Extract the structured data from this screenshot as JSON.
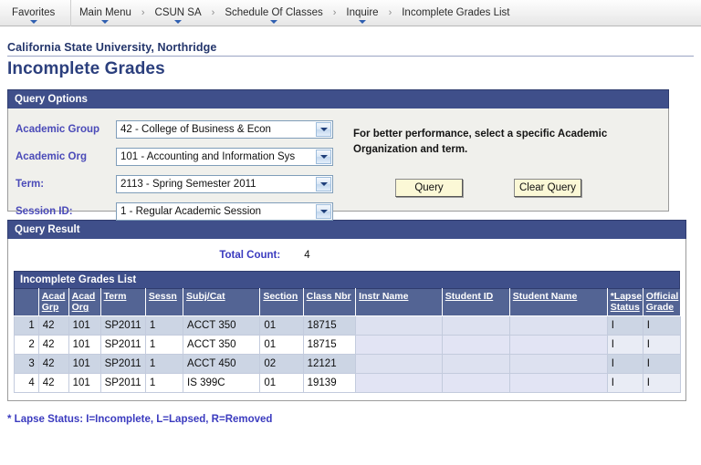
{
  "breadcrumb": {
    "items": [
      {
        "label": "Favorites",
        "has_caret": true,
        "separator_before": false
      },
      {
        "label": "Main Menu",
        "has_caret": true,
        "separator_before": true
      },
      {
        "label": "CSUN SA",
        "has_caret": true,
        "separator_before": false
      },
      {
        "label": "Schedule Of Classes",
        "has_caret": true,
        "separator_before": false
      },
      {
        "label": "Inquire",
        "has_caret": true,
        "separator_before": false
      },
      {
        "label": "Incomplete Grades List",
        "has_caret": false,
        "separator_before": false
      }
    ],
    "chevron": "›"
  },
  "header": {
    "university": "California State University, Northridge",
    "page_title": "Incomplete Grades"
  },
  "query_options": {
    "section_title": "Query Options",
    "fields": [
      {
        "label": "Academic Group",
        "value": "42 - College of Business & Econ"
      },
      {
        "label": "Academic Org",
        "value": "101 - Accounting and Information Sys"
      },
      {
        "label": "Term:",
        "value": "2113 - Spring Semester 2011"
      },
      {
        "label": "Session ID:",
        "value": "1 - Regular Academic Session"
      }
    ],
    "hint": "For better performance,  select a specific Academic Organization and term.",
    "query_button": "Query",
    "clear_button": "Clear Query"
  },
  "query_result": {
    "section_title": "Query Result",
    "total_count_label": "Total Count:",
    "total_count_value": "4",
    "grid_title": "Incomplete Grades List",
    "columns": [
      "",
      "Acad Grp",
      "Acad Org",
      "Term",
      "Sessn",
      "Subj/Cat",
      "Section",
      "Class Nbr",
      "Instr Name",
      "Student ID",
      "Student Name",
      "*Lapse Status",
      "Official Grade"
    ],
    "rows": [
      {
        "n": "1",
        "acad_grp": "42",
        "acad_org": "101",
        "term": "SP2011",
        "sessn": "1",
        "subj_cat": "ACCT  350",
        "section": "01",
        "class_nbr": "18715",
        "instr_name": "",
        "student_id": "",
        "student_name": "",
        "lapse_status": "I",
        "official_grade": "I"
      },
      {
        "n": "2",
        "acad_grp": "42",
        "acad_org": "101",
        "term": "SP2011",
        "sessn": "1",
        "subj_cat": "ACCT  350",
        "section": "01",
        "class_nbr": "18715",
        "instr_name": "",
        "student_id": "",
        "student_name": "",
        "lapse_status": "I",
        "official_grade": "I"
      },
      {
        "n": "3",
        "acad_grp": "42",
        "acad_org": "101",
        "term": "SP2011",
        "sessn": "1",
        "subj_cat": "ACCT  450",
        "section": "02",
        "class_nbr": "12121",
        "instr_name": "",
        "student_id": "",
        "student_name": "",
        "lapse_status": "I",
        "official_grade": "I"
      },
      {
        "n": "4",
        "acad_grp": "42",
        "acad_org": "101",
        "term": "SP2011",
        "sessn": "1",
        "subj_cat": "IS  399C",
        "section": "01",
        "class_nbr": "19139",
        "instr_name": "",
        "student_id": "",
        "student_name": "",
        "lapse_status": "I",
        "official_grade": "I"
      }
    ]
  },
  "footnote": "* Lapse Status: I=Incomplete, L=Lapsed, R=Removed",
  "colors": {
    "header_blue": "#3f4f8a",
    "grid_header_blue": "#536494",
    "label_blue": "#4a4ab8",
    "title_blue": "#2b3f7d",
    "button_yellow": "#fbf8d6",
    "row_alt": "#ccd5e4"
  }
}
